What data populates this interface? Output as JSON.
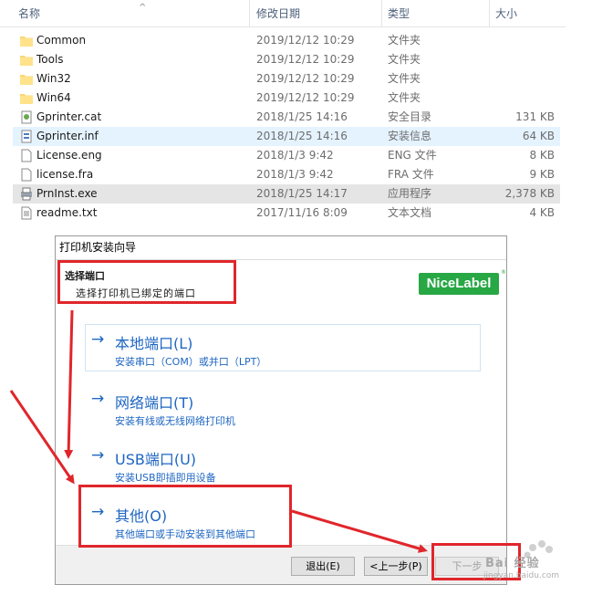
{
  "explorer": {
    "columns": {
      "name": "名称",
      "date": "修改日期",
      "type": "类型",
      "size": "大小"
    },
    "files": [
      {
        "name": "Common",
        "date": "2019/12/12 10:29",
        "type": "文件夹",
        "size": "",
        "icon": "folder-icon"
      },
      {
        "name": "Tools",
        "date": "2019/12/12 10:29",
        "type": "文件夹",
        "size": "",
        "icon": "folder-icon"
      },
      {
        "name": "Win32",
        "date": "2019/12/12 10:29",
        "type": "文件夹",
        "size": "",
        "icon": "folder-icon"
      },
      {
        "name": "Win64",
        "date": "2019/12/12 10:29",
        "type": "文件夹",
        "size": "",
        "icon": "folder-icon"
      },
      {
        "name": "Gprinter.cat",
        "date": "2018/1/25 14:16",
        "type": "安全目录",
        "size": "131 KB",
        "icon": "catalog-icon"
      },
      {
        "name": "Gprinter.inf",
        "date": "2018/1/25 14:16",
        "type": "安装信息",
        "size": "64 KB",
        "icon": "setup-info-icon"
      },
      {
        "name": "License.eng",
        "date": "2018/1/3 9:42",
        "type": "ENG 文件",
        "size": "8 KB",
        "icon": "document-icon"
      },
      {
        "name": "license.fra",
        "date": "2018/1/3 9:42",
        "type": "FRA 文件",
        "size": "9 KB",
        "icon": "document-icon"
      },
      {
        "name": "PrnInst.exe",
        "date": "2018/1/25 14:17",
        "type": "应用程序",
        "size": "2,378 KB",
        "icon": "printer-exe-icon"
      },
      {
        "name": "readme.txt",
        "date": "2017/11/16 8:09",
        "type": "文本文档",
        "size": "4 KB",
        "icon": "text-file-icon"
      }
    ]
  },
  "wizard": {
    "title": "打印机安装向导",
    "header_title": "选择端口",
    "header_subtitle": "选择打印机已绑定的端口",
    "logo_text": "NiceLabel",
    "logo_mark": "®",
    "options": [
      {
        "title": "本地端口(L)",
        "desc": "安装串口（COM）或并口（LPT）"
      },
      {
        "title": "网络端口(T)",
        "desc": "安装有线或无线网络打印机"
      },
      {
        "title": "USB端口(U)",
        "desc": "安装USB即插即用设备"
      },
      {
        "title": "其他(O)",
        "desc": "其他端口或手动安装到其他端口"
      }
    ],
    "buttons": {
      "exit": "退出(E)",
      "back": "<上一步(P)",
      "next": "下一步"
    }
  },
  "watermark": {
    "text": "Bai 经验",
    "url": "jingyan.baidu.com"
  },
  "colors": {
    "annotation_red": "#e0262b",
    "link_blue": "#1e66c2",
    "logo_green": "#28a745"
  }
}
